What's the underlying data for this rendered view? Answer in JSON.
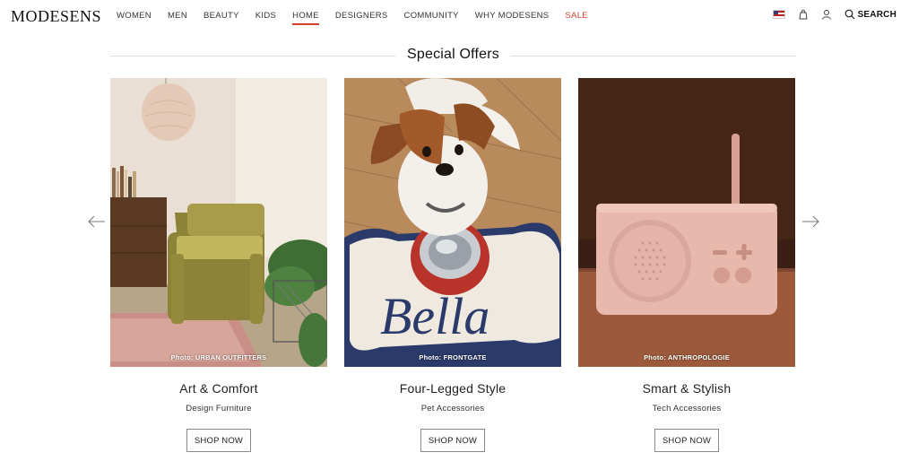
{
  "header": {
    "logo": "MODESENS",
    "nav": [
      {
        "label": "WOMEN"
      },
      {
        "label": "MEN"
      },
      {
        "label": "BEAUTY"
      },
      {
        "label": "KIDS"
      },
      {
        "label": "HOME",
        "active": true
      },
      {
        "label": "DESIGNERS"
      },
      {
        "label": "COMMUNITY"
      },
      {
        "label": "WHY MODESENS"
      },
      {
        "label": "SALE"
      }
    ],
    "search_label": "SEARCH",
    "icons": [
      "us-flag-icon",
      "bag-icon",
      "user-icon",
      "search-icon"
    ]
  },
  "section": {
    "title": "Special Offers"
  },
  "cards": [
    {
      "title": "Art & Comfort",
      "subtitle": "Design Furniture",
      "credit": "Photo: URBAN OUTFITTERS",
      "button": "SHOP NOW"
    },
    {
      "title": "Four-Legged Style",
      "subtitle": "Pet Accessories",
      "credit": "Photo: FRONTGATE",
      "button": "SHOP NOW",
      "mat_text": "Bella"
    },
    {
      "title": "Smart & Stylish",
      "subtitle": "Tech Accessories",
      "credit": "Photo: ANTHROPOLOGIE",
      "button": "SHOP NOW"
    }
  ],
  "colors": {
    "accent": "#d0402b",
    "text": "#222222"
  }
}
